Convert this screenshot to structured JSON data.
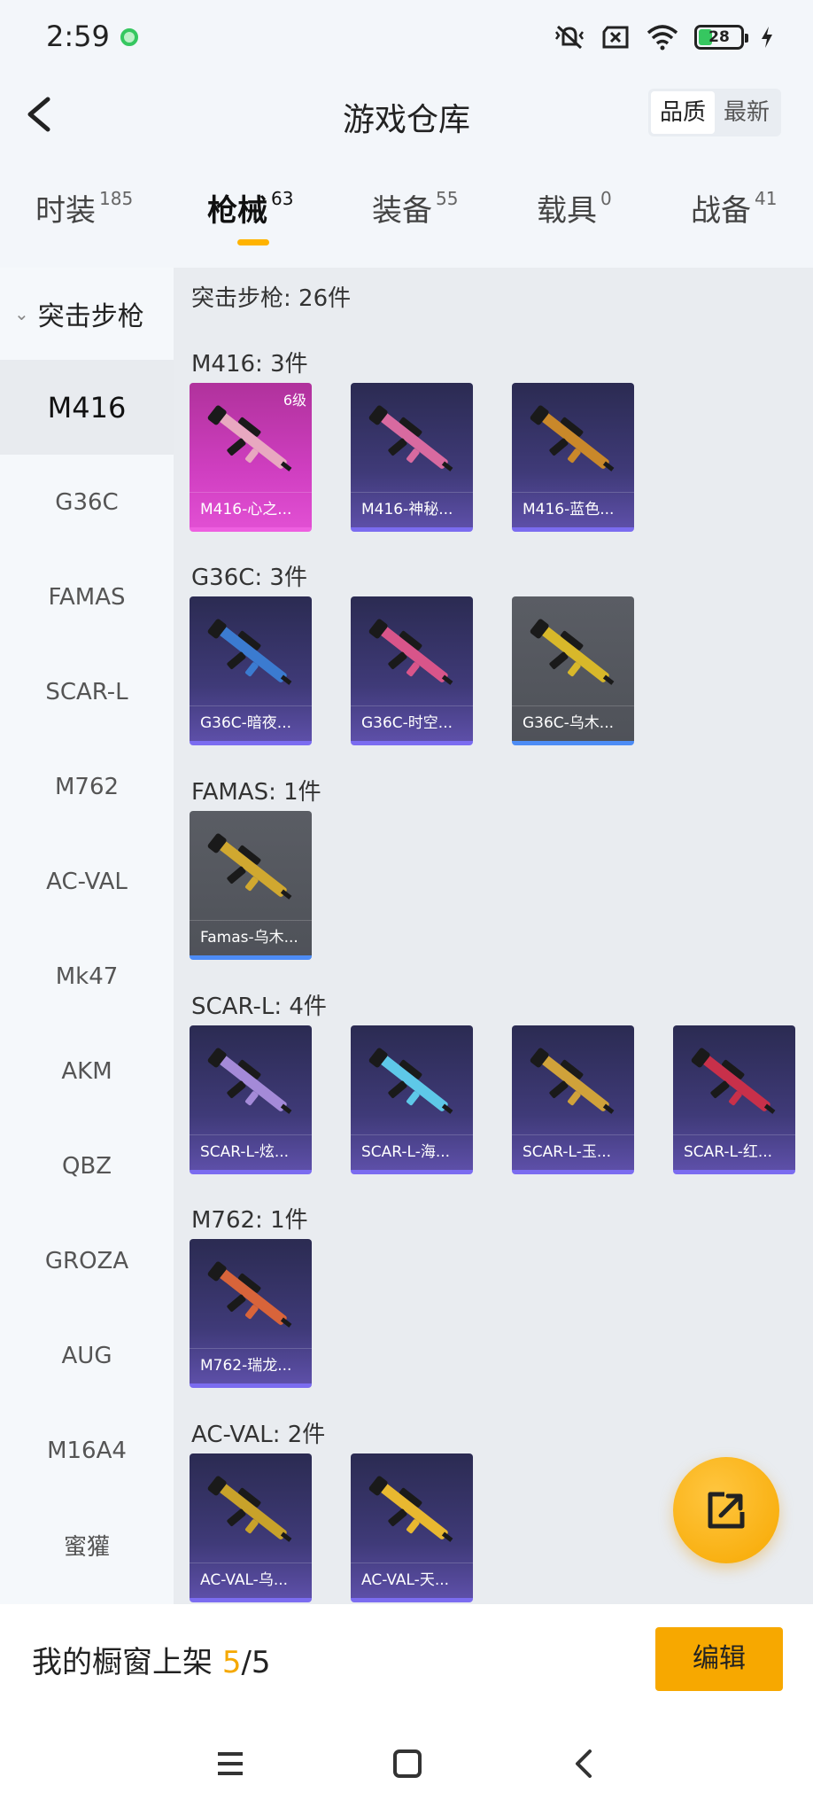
{
  "status": {
    "time": "2:59",
    "battery": "28"
  },
  "header": {
    "title": "游戏仓库",
    "sort_options": [
      "品质",
      "最新"
    ]
  },
  "tabs": [
    {
      "label": "时装",
      "count": "185"
    },
    {
      "label": "枪械",
      "count": "63"
    },
    {
      "label": "装备",
      "count": "55"
    },
    {
      "label": "载具",
      "count": "0"
    },
    {
      "label": "战备",
      "count": "41"
    }
  ],
  "sidebar": {
    "category": "突击步枪",
    "items": [
      "M416",
      "G36C",
      "FAMAS",
      "SCAR-L",
      "M762",
      "AC-VAL",
      "Mk47",
      "AKM",
      "QBZ",
      "GROZA",
      "AUG",
      "M16A4",
      "蜜獾"
    ]
  },
  "main": {
    "category_header": "突击步枪: 26件",
    "groups": [
      {
        "title": "M416: 3件",
        "items": [
          {
            "name": "M416-心之...",
            "level": "6级",
            "rarity": "pink",
            "gun_color": "#e8a8c0"
          },
          {
            "name": "M416-神秘...",
            "rarity": "purple",
            "gun_color": "#d86aa0"
          },
          {
            "name": "M416-蓝色...",
            "rarity": "purple",
            "gun_color": "#c9882a"
          }
        ]
      },
      {
        "title": "G36C: 3件",
        "items": [
          {
            "name": "G36C-暗夜...",
            "rarity": "purple",
            "gun_color": "#3b7bd0"
          },
          {
            "name": "G36C-时空...",
            "rarity": "purple",
            "gun_color": "#d8558a"
          },
          {
            "name": "G36C-乌木...",
            "rarity": "gray",
            "gun_color": "#d8b82a"
          }
        ]
      },
      {
        "title": "FAMAS: 1件",
        "items": [
          {
            "name": "Famas-乌木...",
            "rarity": "gray",
            "gun_color": "#d0a830"
          }
        ]
      },
      {
        "title": "SCAR-L: 4件",
        "items": [
          {
            "name": "SCAR-L-炫...",
            "rarity": "purple",
            "gun_color": "#a48ad8"
          },
          {
            "name": "SCAR-L-海...",
            "rarity": "purple",
            "gun_color": "#5ec8e8"
          },
          {
            "name": "SCAR-L-玉...",
            "rarity": "purple",
            "gun_color": "#d0a23a"
          },
          {
            "name": "SCAR-L-红...",
            "rarity": "purple",
            "gun_color": "#c8304a"
          }
        ]
      },
      {
        "title": "M762: 1件",
        "items": [
          {
            "name": "M762-瑞龙...",
            "rarity": "purple",
            "gun_color": "#d8643a"
          }
        ]
      },
      {
        "title": "AC-VAL: 2件",
        "items": [
          {
            "name": "AC-VAL-乌...",
            "rarity": "purple",
            "gun_color": "#c8a22a"
          },
          {
            "name": "AC-VAL-天...",
            "rarity": "purple",
            "gun_color": "#e8b830"
          }
        ]
      }
    ]
  },
  "bottom": {
    "showcase_label": "我的橱窗上架",
    "showcase_count": "5",
    "showcase_sep": "/",
    "showcase_total": "5",
    "edit_label": "编辑"
  },
  "colors": {
    "accent": "#f7a800",
    "pink_rarity": "#e14fd3",
    "purple_rarity": "#5d4fa8"
  },
  "icons": [
    "back-arrow-icon",
    "export-icon",
    "menu-icon",
    "home-icon",
    "back-icon"
  ]
}
